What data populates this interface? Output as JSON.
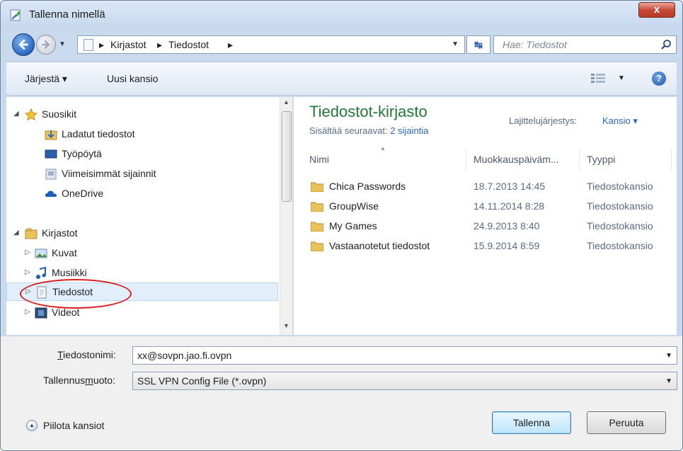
{
  "window": {
    "title": "Tallenna nimellä",
    "close_label": "x"
  },
  "address_bar": {
    "crumbs": [
      "Kirjastot",
      "Tiedostot"
    ],
    "search_placeholder": "Hae: Tiedostot"
  },
  "toolbar": {
    "organize_label": "Järjestä ▾",
    "new_folder_label": "Uusi kansio",
    "help_label": "?"
  },
  "nav_pane": {
    "favorites_label": "Suosikit",
    "favorites": [
      "Ladatut tiedostot",
      "Työpöytä",
      "Viimeisimmät sijainnit",
      "OneDrive"
    ],
    "libraries_label": "Kirjastot",
    "libraries": [
      "Kuvat",
      "Musiikki",
      "Tiedostot",
      "Videot"
    ],
    "selected": "Tiedostot"
  },
  "content": {
    "library_title": "Tiedostot-kirjasto",
    "subtitle_prefix": "Sisältää seuraavat:",
    "subtitle_link": "2 sijaintia",
    "sort_label": "Lajittelujärjestys:",
    "sort_value": "Kansio ▾",
    "columns": [
      "Nimi",
      "Muokkauspäiväm...",
      "Tyyppi"
    ],
    "files": [
      {
        "name": "Chica Passwords",
        "date": "18.7.2013 14:45",
        "type": "Tiedostokansio"
      },
      {
        "name": "GroupWise",
        "date": "14.11.2014 8:28",
        "type": "Tiedostokansio"
      },
      {
        "name": "My Games",
        "date": "24.9.2013 8:40",
        "type": "Tiedostokansio"
      },
      {
        "name": "Vastaanotetut tiedostot",
        "date": "15.9.2014 8:59",
        "type": "Tiedostokansio"
      }
    ]
  },
  "bottom": {
    "filename_label_pre": "",
    "filename_label_u": "T",
    "filename_label_post": "iedostonimi:",
    "filename_value": "xx@sovpn.jao.fi.ovpn",
    "format_label_pre": "Tallennus",
    "format_label_u": "m",
    "format_label_post": "uoto:",
    "format_value": "SSL VPN Config File (*.ovpn)",
    "hide_folders_label": "Piilota kansiot",
    "save_label": "Tallenna",
    "cancel_label": "Peruuta"
  },
  "colors": {
    "accent": "#2a66c9",
    "library_title": "#1e7a34",
    "highlight_ring": "#d81e1e"
  }
}
